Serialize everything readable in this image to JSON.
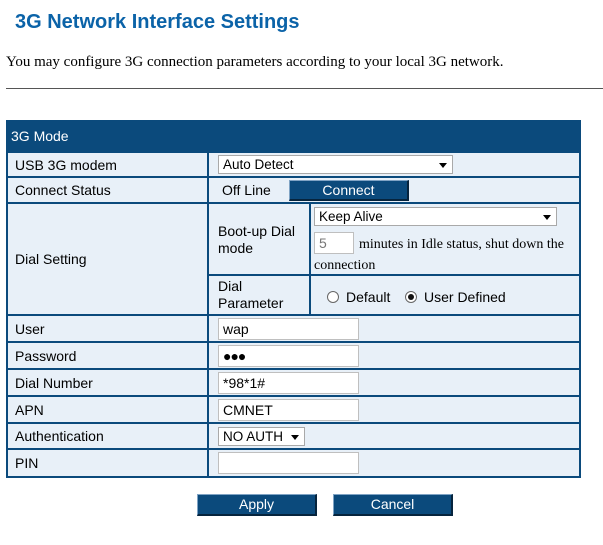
{
  "page": {
    "title": "3G Network Interface Settings",
    "description": "You may configure 3G connection parameters according to your local 3G network."
  },
  "panel": {
    "header": "3G Mode"
  },
  "usb_modem": {
    "label": "USB 3G modem",
    "selected": "Auto Detect"
  },
  "connect_status": {
    "label": "Connect Status",
    "status": "Off Line",
    "button": "Connect"
  },
  "dial_setting": {
    "label": "Dial Setting",
    "boot_mode": {
      "label": "Boot-up Dial mode",
      "selected": "Keep Alive",
      "idle_value": "5",
      "idle_text": "minutes in Idle status, shut down the connection"
    },
    "dial_parameter": {
      "label": "Dial Parameter",
      "options": [
        "Default",
        "User Defined"
      ],
      "selected": "User Defined"
    }
  },
  "user": {
    "label": "User",
    "value": "wap"
  },
  "password": {
    "label": "Password",
    "value": "●●●"
  },
  "dial_number": {
    "label": "Dial Number",
    "value": "*98*1#"
  },
  "apn": {
    "label": "APN",
    "value": "CMNET"
  },
  "authentication": {
    "label": "Authentication",
    "selected": "NO AUTH"
  },
  "pin": {
    "label": "PIN",
    "value": ""
  },
  "buttons": {
    "apply": "Apply",
    "cancel": "Cancel"
  },
  "colors": {
    "title": "#0b63a8",
    "panel": "#0b4a7c",
    "cell": "#e8f0f8"
  }
}
